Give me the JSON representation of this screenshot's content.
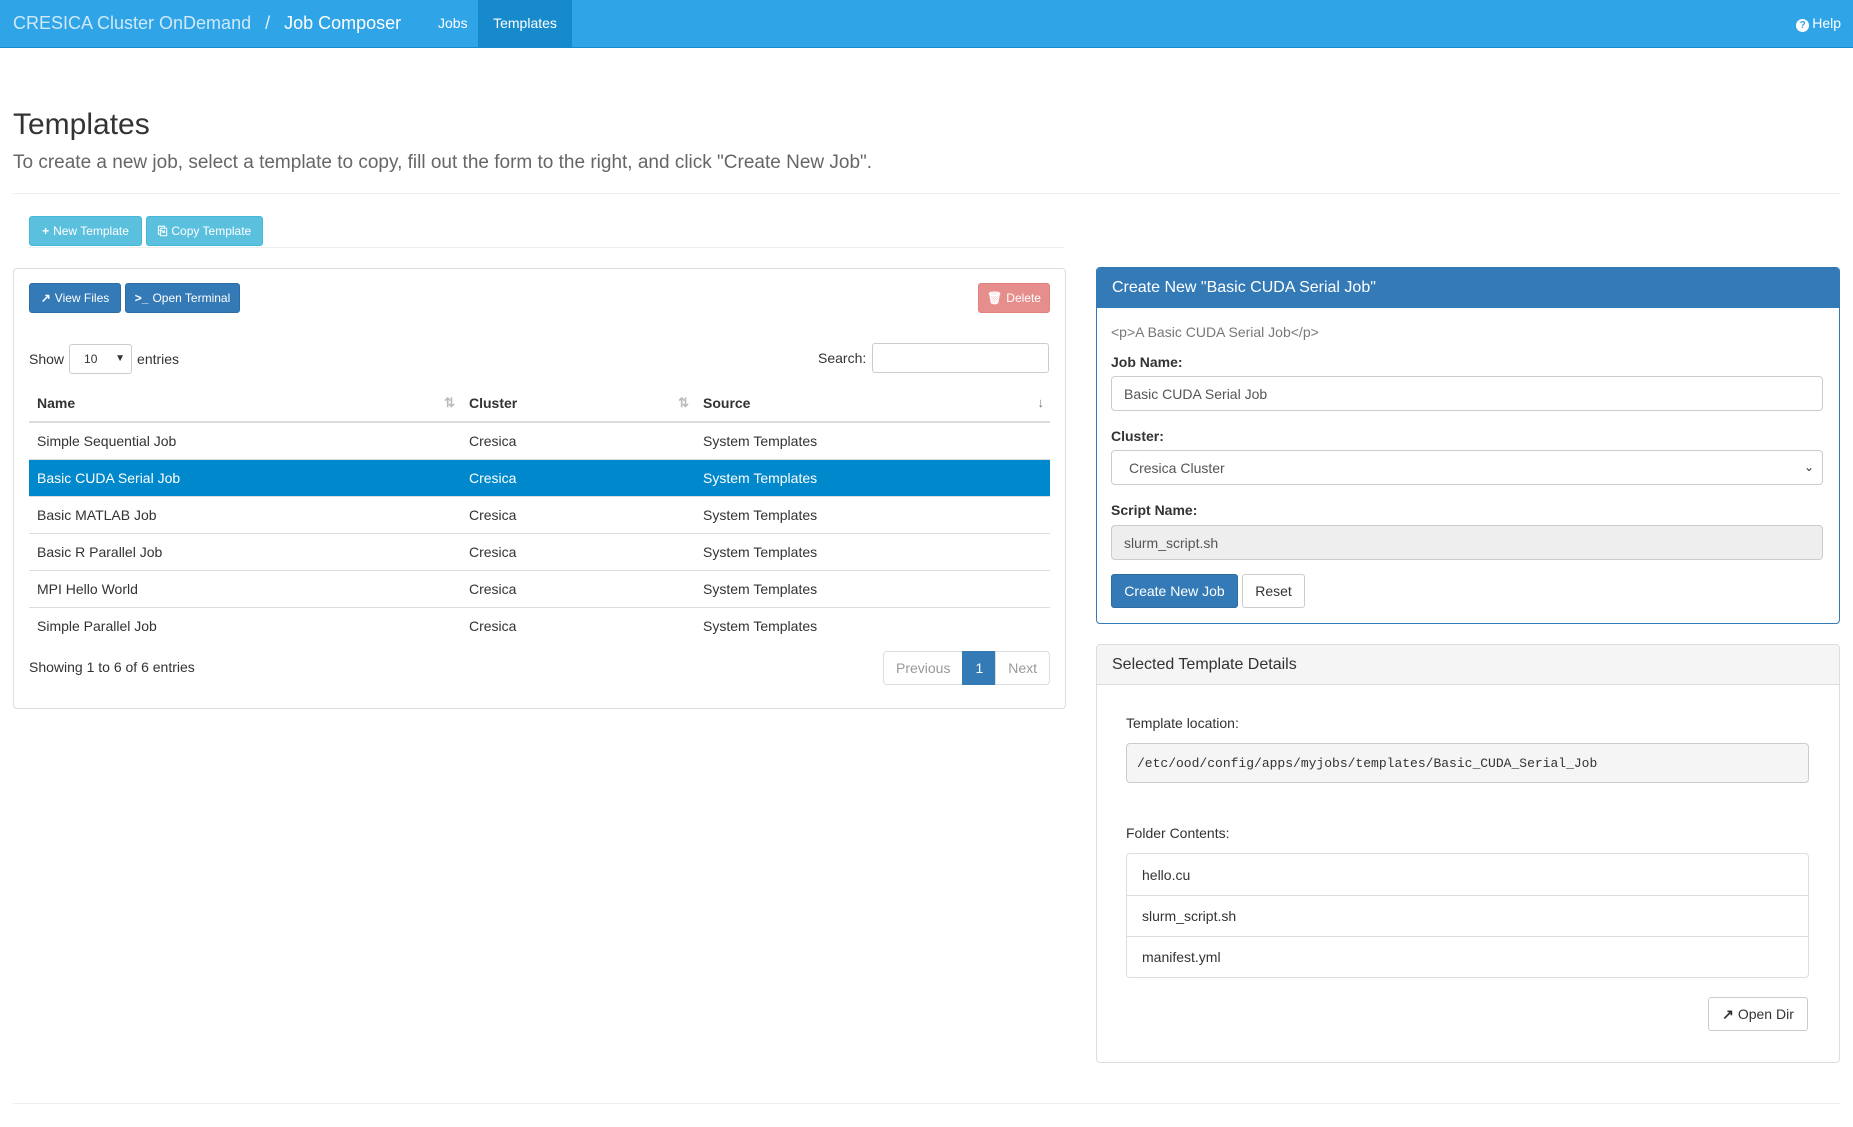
{
  "navbar": {
    "brand": "CRESICA Cluster OnDemand",
    "separator": "/",
    "app_name": "Job Composer",
    "tabs": [
      {
        "label": "Jobs",
        "active": false
      },
      {
        "label": "Templates",
        "active": true
      }
    ],
    "help_label": "Help",
    "help_icon": "question-circle-icon"
  },
  "header": {
    "title": "Templates",
    "subtitle": "To create a new job, select a template to copy, fill out the form to the right, and click \"Create New Job\"."
  },
  "toolbar": {
    "new_template_label": "New Template",
    "new_template_icon": "plus-icon",
    "copy_template_label": "Copy Template",
    "copy_template_icon": "copy-icon"
  },
  "table_panel": {
    "view_files_label": "View Files",
    "open_terminal_label": "Open Terminal",
    "delete_label": "Delete",
    "show_label": "Show",
    "entries_label": "entries",
    "page_size": "10",
    "search_label": "Search:",
    "search_value": "",
    "columns": [
      "Name",
      "Cluster",
      "Source"
    ],
    "rows": [
      {
        "name": "Simple Sequential Job",
        "cluster": "Cresica",
        "source": "System Templates",
        "selected": false
      },
      {
        "name": "Basic CUDA Serial Job",
        "cluster": "Cresica",
        "source": "System Templates",
        "selected": true
      },
      {
        "name": "Basic MATLAB Job",
        "cluster": "Cresica",
        "source": "System Templates",
        "selected": false
      },
      {
        "name": "Basic R Parallel Job",
        "cluster": "Cresica",
        "source": "System Templates",
        "selected": false
      },
      {
        "name": "MPI Hello World",
        "cluster": "Cresica",
        "source": "System Templates",
        "selected": false
      },
      {
        "name": "Simple Parallel Job",
        "cluster": "Cresica",
        "source": "System Templates",
        "selected": false
      }
    ],
    "info": "Showing 1 to 6 of 6 entries",
    "pagination": {
      "previous": "Previous",
      "current": "1",
      "next": "Next"
    }
  },
  "form": {
    "heading": "Create New \"Basic CUDA Serial Job\"",
    "description": "<p>A Basic CUDA Serial Job</p>",
    "job_name_label": "Job Name:",
    "job_name_value": "Basic CUDA Serial Job",
    "cluster_label": "Cluster:",
    "cluster_value": "Cresica Cluster",
    "script_name_label": "Script Name:",
    "script_name_value": "slurm_script.sh",
    "create_label": "Create New Job",
    "reset_label": "Reset"
  },
  "details": {
    "heading": "Selected Template Details",
    "location_label": "Template location:",
    "location_value": "/etc/ood/config/apps/myjobs/templates/Basic_CUDA_Serial_Job",
    "folder_label": "Folder Contents:",
    "files": [
      "hello.cu",
      "slurm_script.sh",
      "manifest.yml"
    ],
    "open_dir_label": "Open Dir",
    "open_dir_icon": "external-link-icon"
  },
  "colors": {
    "navbar": "#2fa4e7",
    "navbar_active": "#178acc",
    "primary": "#337ab7",
    "info": "#5bc0de",
    "danger": "#d9534f",
    "row_selected": "#0088cc"
  }
}
